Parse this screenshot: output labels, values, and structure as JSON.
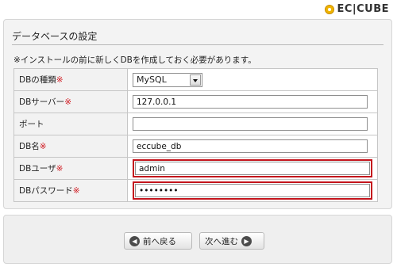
{
  "logo": {
    "text": "EC|CUBE"
  },
  "section": {
    "title": "データベースの設定",
    "notice": "※インストールの前に新しくDBを作成しておく必要があります。"
  },
  "form": {
    "rows": [
      {
        "label": "DBの種類",
        "required_mark": "※",
        "value": "MySQL",
        "type": "select"
      },
      {
        "label": "DBサーバー",
        "required_mark": "※",
        "value": "127.0.0.1",
        "type": "text"
      },
      {
        "label": "ポート",
        "required_mark": "",
        "value": "",
        "type": "text"
      },
      {
        "label": "DB名",
        "required_mark": "※",
        "value": "eccube_db",
        "type": "text"
      },
      {
        "label": "DBユーザ",
        "required_mark": "※",
        "value": "admin",
        "type": "text",
        "highlighted": true
      },
      {
        "label": "DBパスワード",
        "required_mark": "※",
        "value": "••••••••",
        "type": "password",
        "highlighted": true
      }
    ]
  },
  "buttons": {
    "back_label": "前へ戻る",
    "next_label": "次へ進む"
  },
  "colors": {
    "required": "#d0181f",
    "highlight_border": "#c4141c"
  },
  "icons": {
    "back": "arrow-left-circle-icon",
    "next": "arrow-right-circle-icon"
  }
}
